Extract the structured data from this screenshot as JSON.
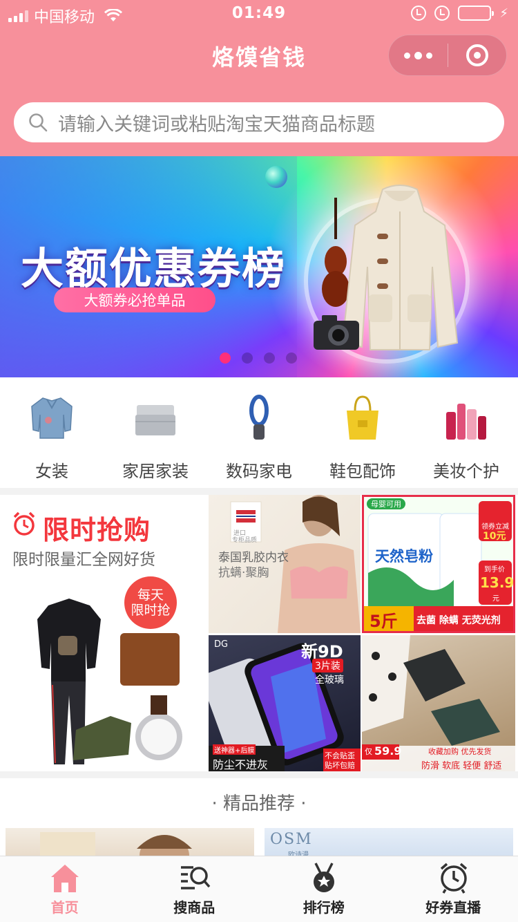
{
  "status_bar": {
    "carrier": "中国移动",
    "time": "01:49"
  },
  "nav": {
    "title": "烙馍省钱"
  },
  "search": {
    "placeholder": "请输入关键词或粘贴淘宝天猫商品标题"
  },
  "banner": {
    "title": "大额优惠券榜",
    "subtitle": "大额券必抢单品",
    "slides": 4,
    "active_slide": 1
  },
  "categories": [
    {
      "label": "女装",
      "icon": "denim-jacket-icon"
    },
    {
      "label": "家居家装",
      "icon": "bedding-icon"
    },
    {
      "label": "数码家电",
      "icon": "bladeless-fan-icon"
    },
    {
      "label": "鞋包配饰",
      "icon": "tote-bag-icon"
    },
    {
      "label": "美妆个护",
      "icon": "cosmetics-icon"
    }
  ],
  "flash_sale": {
    "title": "限时抢购",
    "subtitle": "限时限量汇全网好货",
    "badge": "每天\n限时抢"
  },
  "promo_tiles": {
    "bra": {
      "tag_line1": "进口",
      "tag_line2": "专柜品质",
      "line1": "泰国乳胶内衣",
      "line2": "抗螨·聚胸"
    },
    "soap": {
      "tag": "母婴可用",
      "name": "天然皂粉",
      "coupon": "领券立减",
      "coupon_value": "10元",
      "price_label": "到手价",
      "price": "13.9",
      "price_unit": "元",
      "weight": "5斤",
      "features": "去菌 除螨 无荧光剂"
    },
    "phone": {
      "brand": "DG",
      "title": "新9D",
      "pack": "3片装",
      "glass": "全玻璃",
      "gift": "送神器+后膜",
      "slogan": "防尘不进灰",
      "guarantee1": "不会贴歪",
      "guarantee2": "贴坏包赔"
    },
    "shoe": {
      "promo": "收藏加购 优先发货",
      "price_prefix": "仅",
      "price": "59.9",
      "features": "防滑 软底 轻便 舒适"
    }
  },
  "recommend": {
    "title": "· 精品推荐 ·",
    "card2_brand": "OSM",
    "card2_brand_sub": "欧诗漫"
  },
  "tabbar": [
    {
      "label": "首页",
      "icon": "home-icon",
      "active": true
    },
    {
      "label": "搜商品",
      "icon": "search-list-icon",
      "active": false
    },
    {
      "label": "排行榜",
      "icon": "medal-icon",
      "active": false
    },
    {
      "label": "好券直播",
      "icon": "alarm-clock-icon",
      "active": false
    }
  ],
  "colors": {
    "primary_pink": "#f7909b",
    "flash_red": "#f3373d",
    "tab_active": "#f7909b"
  }
}
